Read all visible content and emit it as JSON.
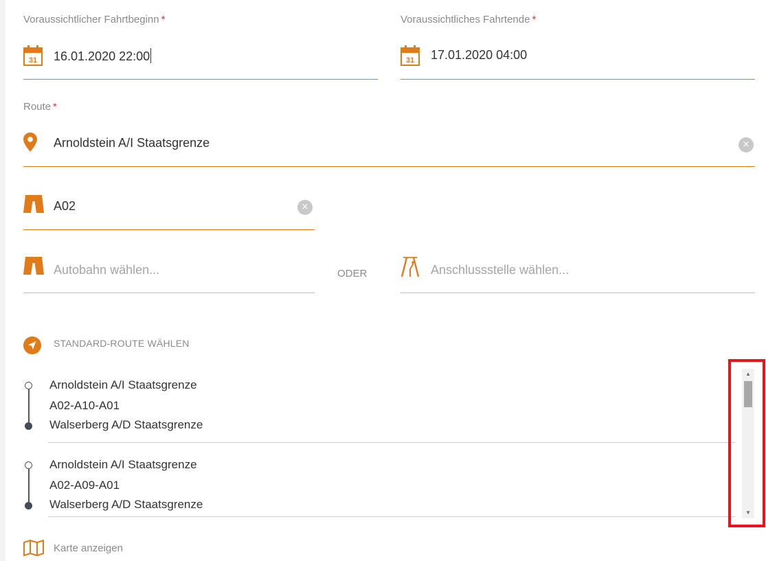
{
  "form": {
    "start": {
      "label": "Voraussichtlicher Fahrtbeginn",
      "required_mark": "*",
      "value": "16.01.2020 22:00",
      "calendar_day": "31"
    },
    "end": {
      "label": "Voraussichtliches Fahrtende",
      "required_mark": "*",
      "value": "17.01.2020 04:00",
      "calendar_day": "31"
    },
    "route": {
      "label": "Route",
      "required_mark": "*",
      "value": "Arnoldstein A/I Staatsgrenze",
      "clear_glyph": "×"
    },
    "highway_selected": {
      "value": "A02",
      "clear_glyph": "×"
    },
    "highway_select": {
      "placeholder": "Autobahn wählen..."
    },
    "or_label": "ODER",
    "junction_select": {
      "placeholder": "Anschlussstelle wählen..."
    }
  },
  "standard_route": {
    "label": "STANDARD-ROUTE WÄHLEN",
    "items": [
      {
        "from": "Arnoldstein A/I Staatsgrenze",
        "via": "A02-A10-A01",
        "to": "Walserberg A/D Staatsgrenze"
      },
      {
        "from": "Arnoldstein A/I Staatsgrenze",
        "via": "A02-A09-A01",
        "to": "Walserberg A/D Staatsgrenze"
      }
    ]
  },
  "scrollbar": {
    "up_glyph": "▲",
    "down_glyph": "▼"
  },
  "map": {
    "label": "Karte anzeigen"
  },
  "colors": {
    "accent": "#e07b1a",
    "required": "#e0312d",
    "highlight": "#e8141c"
  }
}
